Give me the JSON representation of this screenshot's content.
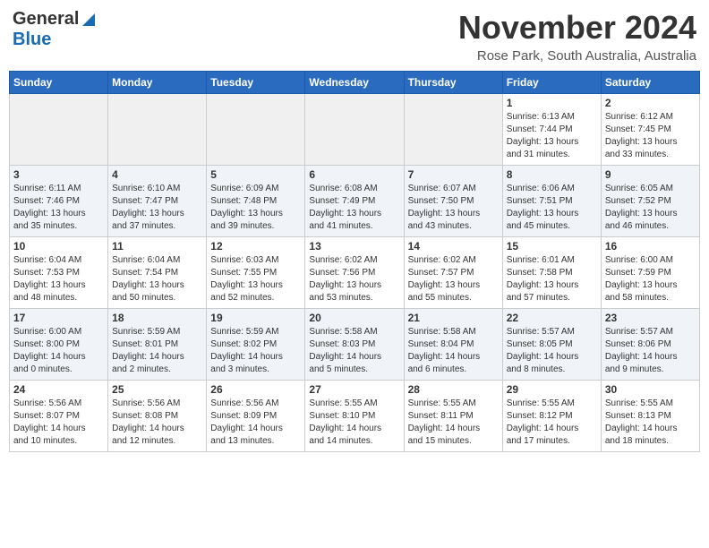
{
  "header": {
    "logo_general": "General",
    "logo_blue": "Blue",
    "month_title": "November 2024",
    "location": "Rose Park, South Australia, Australia"
  },
  "calendar": {
    "days_of_week": [
      "Sunday",
      "Monday",
      "Tuesday",
      "Wednesday",
      "Thursday",
      "Friday",
      "Saturday"
    ],
    "weeks": [
      [
        {
          "day": "",
          "info": ""
        },
        {
          "day": "",
          "info": ""
        },
        {
          "day": "",
          "info": ""
        },
        {
          "day": "",
          "info": ""
        },
        {
          "day": "",
          "info": ""
        },
        {
          "day": "1",
          "info": "Sunrise: 6:13 AM\nSunset: 7:44 PM\nDaylight: 13 hours\nand 31 minutes."
        },
        {
          "day": "2",
          "info": "Sunrise: 6:12 AM\nSunset: 7:45 PM\nDaylight: 13 hours\nand 33 minutes."
        }
      ],
      [
        {
          "day": "3",
          "info": "Sunrise: 6:11 AM\nSunset: 7:46 PM\nDaylight: 13 hours\nand 35 minutes."
        },
        {
          "day": "4",
          "info": "Sunrise: 6:10 AM\nSunset: 7:47 PM\nDaylight: 13 hours\nand 37 minutes."
        },
        {
          "day": "5",
          "info": "Sunrise: 6:09 AM\nSunset: 7:48 PM\nDaylight: 13 hours\nand 39 minutes."
        },
        {
          "day": "6",
          "info": "Sunrise: 6:08 AM\nSunset: 7:49 PM\nDaylight: 13 hours\nand 41 minutes."
        },
        {
          "day": "7",
          "info": "Sunrise: 6:07 AM\nSunset: 7:50 PM\nDaylight: 13 hours\nand 43 minutes."
        },
        {
          "day": "8",
          "info": "Sunrise: 6:06 AM\nSunset: 7:51 PM\nDaylight: 13 hours\nand 45 minutes."
        },
        {
          "day": "9",
          "info": "Sunrise: 6:05 AM\nSunset: 7:52 PM\nDaylight: 13 hours\nand 46 minutes."
        }
      ],
      [
        {
          "day": "10",
          "info": "Sunrise: 6:04 AM\nSunset: 7:53 PM\nDaylight: 13 hours\nand 48 minutes."
        },
        {
          "day": "11",
          "info": "Sunrise: 6:04 AM\nSunset: 7:54 PM\nDaylight: 13 hours\nand 50 minutes."
        },
        {
          "day": "12",
          "info": "Sunrise: 6:03 AM\nSunset: 7:55 PM\nDaylight: 13 hours\nand 52 minutes."
        },
        {
          "day": "13",
          "info": "Sunrise: 6:02 AM\nSunset: 7:56 PM\nDaylight: 13 hours\nand 53 minutes."
        },
        {
          "day": "14",
          "info": "Sunrise: 6:02 AM\nSunset: 7:57 PM\nDaylight: 13 hours\nand 55 minutes."
        },
        {
          "day": "15",
          "info": "Sunrise: 6:01 AM\nSunset: 7:58 PM\nDaylight: 13 hours\nand 57 minutes."
        },
        {
          "day": "16",
          "info": "Sunrise: 6:00 AM\nSunset: 7:59 PM\nDaylight: 13 hours\nand 58 minutes."
        }
      ],
      [
        {
          "day": "17",
          "info": "Sunrise: 6:00 AM\nSunset: 8:00 PM\nDaylight: 14 hours\nand 0 minutes."
        },
        {
          "day": "18",
          "info": "Sunrise: 5:59 AM\nSunset: 8:01 PM\nDaylight: 14 hours\nand 2 minutes."
        },
        {
          "day": "19",
          "info": "Sunrise: 5:59 AM\nSunset: 8:02 PM\nDaylight: 14 hours\nand 3 minutes."
        },
        {
          "day": "20",
          "info": "Sunrise: 5:58 AM\nSunset: 8:03 PM\nDaylight: 14 hours\nand 5 minutes."
        },
        {
          "day": "21",
          "info": "Sunrise: 5:58 AM\nSunset: 8:04 PM\nDaylight: 14 hours\nand 6 minutes."
        },
        {
          "day": "22",
          "info": "Sunrise: 5:57 AM\nSunset: 8:05 PM\nDaylight: 14 hours\nand 8 minutes."
        },
        {
          "day": "23",
          "info": "Sunrise: 5:57 AM\nSunset: 8:06 PM\nDaylight: 14 hours\nand 9 minutes."
        }
      ],
      [
        {
          "day": "24",
          "info": "Sunrise: 5:56 AM\nSunset: 8:07 PM\nDaylight: 14 hours\nand 10 minutes."
        },
        {
          "day": "25",
          "info": "Sunrise: 5:56 AM\nSunset: 8:08 PM\nDaylight: 14 hours\nand 12 minutes."
        },
        {
          "day": "26",
          "info": "Sunrise: 5:56 AM\nSunset: 8:09 PM\nDaylight: 14 hours\nand 13 minutes."
        },
        {
          "day": "27",
          "info": "Sunrise: 5:55 AM\nSunset: 8:10 PM\nDaylight: 14 hours\nand 14 minutes."
        },
        {
          "day": "28",
          "info": "Sunrise: 5:55 AM\nSunset: 8:11 PM\nDaylight: 14 hours\nand 15 minutes."
        },
        {
          "day": "29",
          "info": "Sunrise: 5:55 AM\nSunset: 8:12 PM\nDaylight: 14 hours\nand 17 minutes."
        },
        {
          "day": "30",
          "info": "Sunrise: 5:55 AM\nSunset: 8:13 PM\nDaylight: 14 hours\nand 18 minutes."
        }
      ]
    ]
  }
}
